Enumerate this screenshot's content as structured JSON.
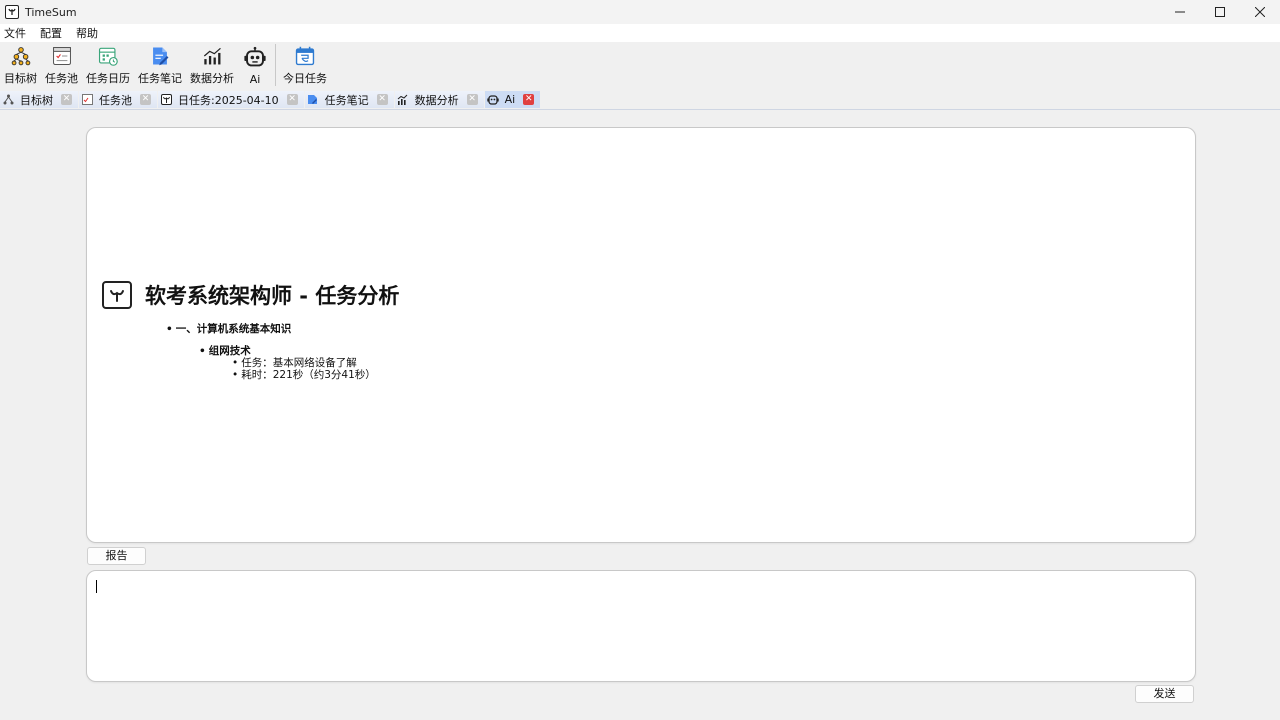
{
  "window": {
    "title": "TimeSum"
  },
  "menu": [
    "文件",
    "配置",
    "帮助"
  ],
  "toolbar": [
    {
      "label": "目标树",
      "icon": "goal-tree-icon"
    },
    {
      "label": "任务池",
      "icon": "task-pool-icon"
    },
    {
      "label": "任务日历",
      "icon": "task-calendar-icon"
    },
    {
      "label": "任务笔记",
      "icon": "task-notes-icon"
    },
    {
      "label": "数据分析",
      "icon": "data-analysis-icon"
    },
    {
      "label": "Ai",
      "icon": "robot-icon"
    },
    {
      "label": "今日任务",
      "icon": "today-tasks-icon"
    }
  ],
  "tabs": [
    {
      "label": "目标树",
      "active": false
    },
    {
      "label": "任务池",
      "active": false
    },
    {
      "label": "日任务:2025-04-10",
      "active": false
    },
    {
      "label": "任务笔记",
      "active": false
    },
    {
      "label": "数据分析",
      "active": false
    },
    {
      "label": "Ai",
      "active": true
    }
  ],
  "report": {
    "title": "软考系统架构师 - 任务分析",
    "section": "一、计算机系统基本知识",
    "subsection": "组网技术",
    "items": [
      "任务：基本网络设备了解",
      "耗时：221秒（约3分41秒）"
    ]
  },
  "buttons": {
    "report": "报告",
    "send": "发送"
  },
  "input": {
    "value": ""
  },
  "colors": {
    "active_tab": "#cddcf4",
    "active_close": "#e04040",
    "panel_border": "#c8c8c8"
  }
}
